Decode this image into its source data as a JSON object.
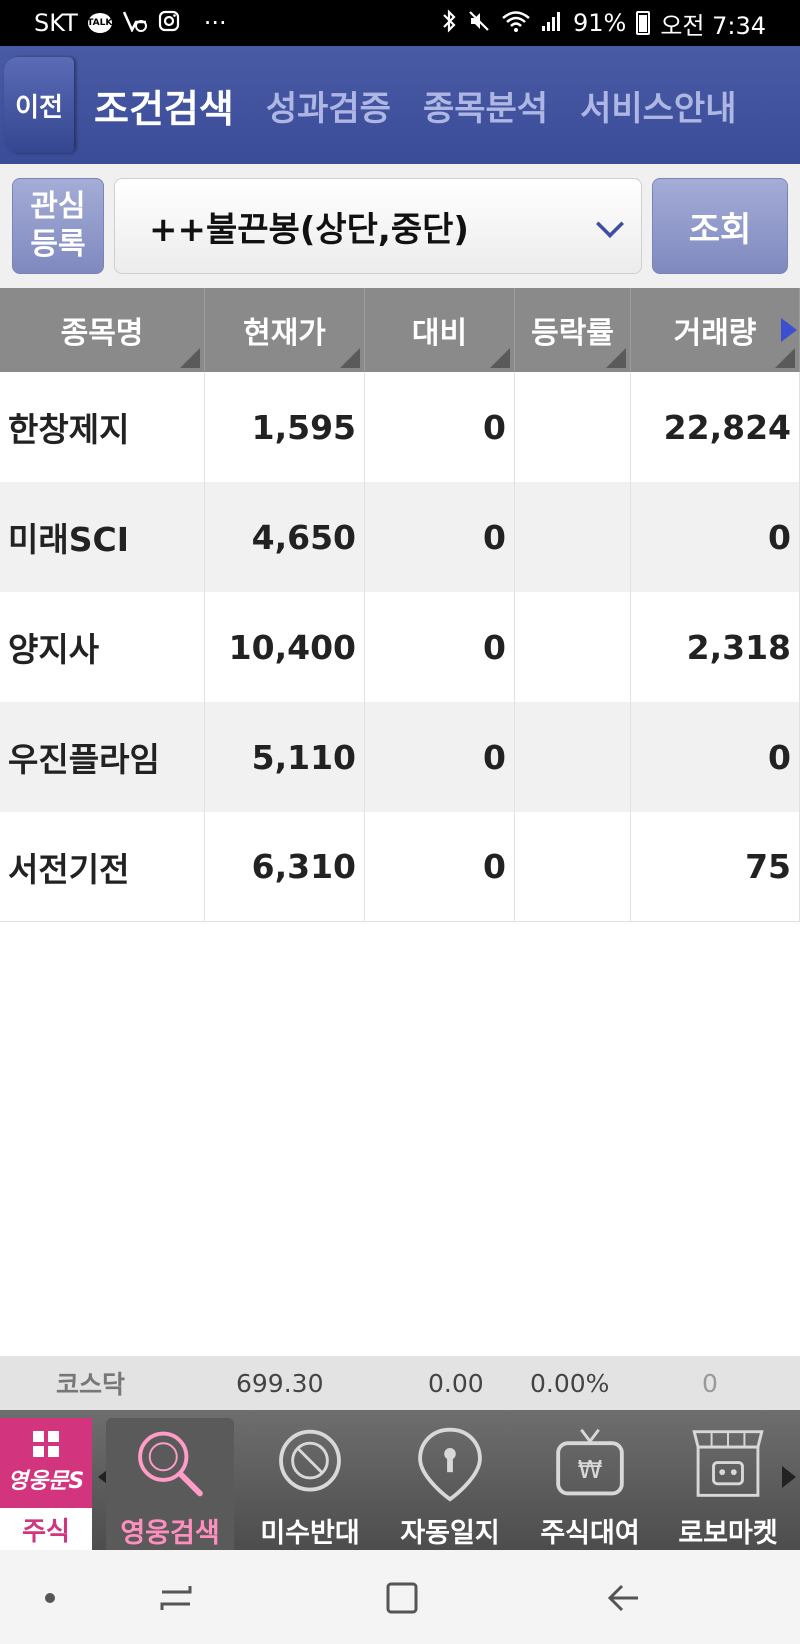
{
  "status_bar": {
    "carrier": "SKT",
    "talk_icon": "TALK",
    "more": "···",
    "battery": "91%",
    "time": "오전 7:34"
  },
  "top_nav": {
    "back_label": "이전",
    "tabs": [
      {
        "label": "조건검색",
        "active": true
      },
      {
        "label": "성과검증",
        "active": false
      },
      {
        "label": "종목분석",
        "active": false
      },
      {
        "label": "서비스안내",
        "active": false
      }
    ]
  },
  "search": {
    "watch_button_line1": "관심",
    "watch_button_line2": "등록",
    "condition_selected": "++불끈봉(상단,중단)",
    "query_button": "조회"
  },
  "table": {
    "columns": [
      "종목명",
      "현재가",
      "대비",
      "등락률",
      "거래량"
    ],
    "rows": [
      {
        "name": "한창제지",
        "price": "1,595",
        "change": "0",
        "rate": "",
        "volume": "22,824"
      },
      {
        "name": "미래SCI",
        "price": "4,650",
        "change": "0",
        "rate": "",
        "volume": "0"
      },
      {
        "name": "양지사",
        "price": "10,400",
        "change": "0",
        "rate": "",
        "volume": "2,318"
      },
      {
        "name": "우진플라임",
        "price": "5,110",
        "change": "0",
        "rate": "",
        "volume": "0"
      },
      {
        "name": "서전기전",
        "price": "6,310",
        "change": "0",
        "rate": "",
        "volume": "75"
      }
    ]
  },
  "index_bar": {
    "name": "코스닥",
    "value": "699.30",
    "change": "0.00",
    "rate": "0.00%",
    "volume": "0"
  },
  "bottom_menu": {
    "brand_logo": "영웅문S",
    "brand_label": "주식",
    "items": [
      {
        "label": "영웅검색",
        "icon": "search-icon",
        "active": true
      },
      {
        "label": "미수반대",
        "icon": "prohibit-icon",
        "active": false
      },
      {
        "label": "자동일지",
        "icon": "keyhole-pin-icon",
        "active": false
      },
      {
        "label": "주식대여",
        "icon": "won-tv-icon",
        "active": false
      },
      {
        "label": "로보마켓",
        "icon": "robot-store-icon",
        "active": false
      }
    ]
  },
  "colors": {
    "nav_blue": "#3a4b97",
    "brand_pink": "#d2357e",
    "header_gray": "#8a8a8a"
  }
}
